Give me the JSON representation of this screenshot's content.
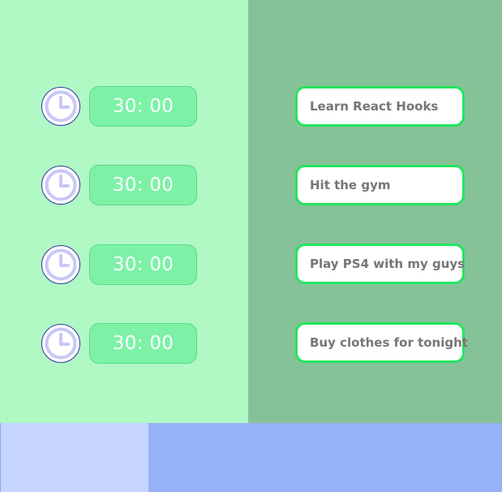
{
  "colors": {
    "left_panel": "#b0f8c4",
    "right_panel": "#86c298",
    "timer_fill": "#7df2a7",
    "task_border": "#22e55e",
    "clock_face": "#c9c7f6",
    "footer_left": "#c5d5ff",
    "footer_right": "#97b1f6"
  },
  "timers": [
    {
      "icon": "clock-icon",
      "time": "30: 00"
    },
    {
      "icon": "clock-icon",
      "time": "30: 00"
    },
    {
      "icon": "clock-icon",
      "time": "30: 00"
    },
    {
      "icon": "clock-icon",
      "time": "30: 00"
    }
  ],
  "tasks": [
    {
      "label": "Learn React Hooks"
    },
    {
      "label": "Hit the gym"
    },
    {
      "label": "Play PS4 with my guys"
    },
    {
      "label": "Buy clothes for tonight"
    }
  ]
}
